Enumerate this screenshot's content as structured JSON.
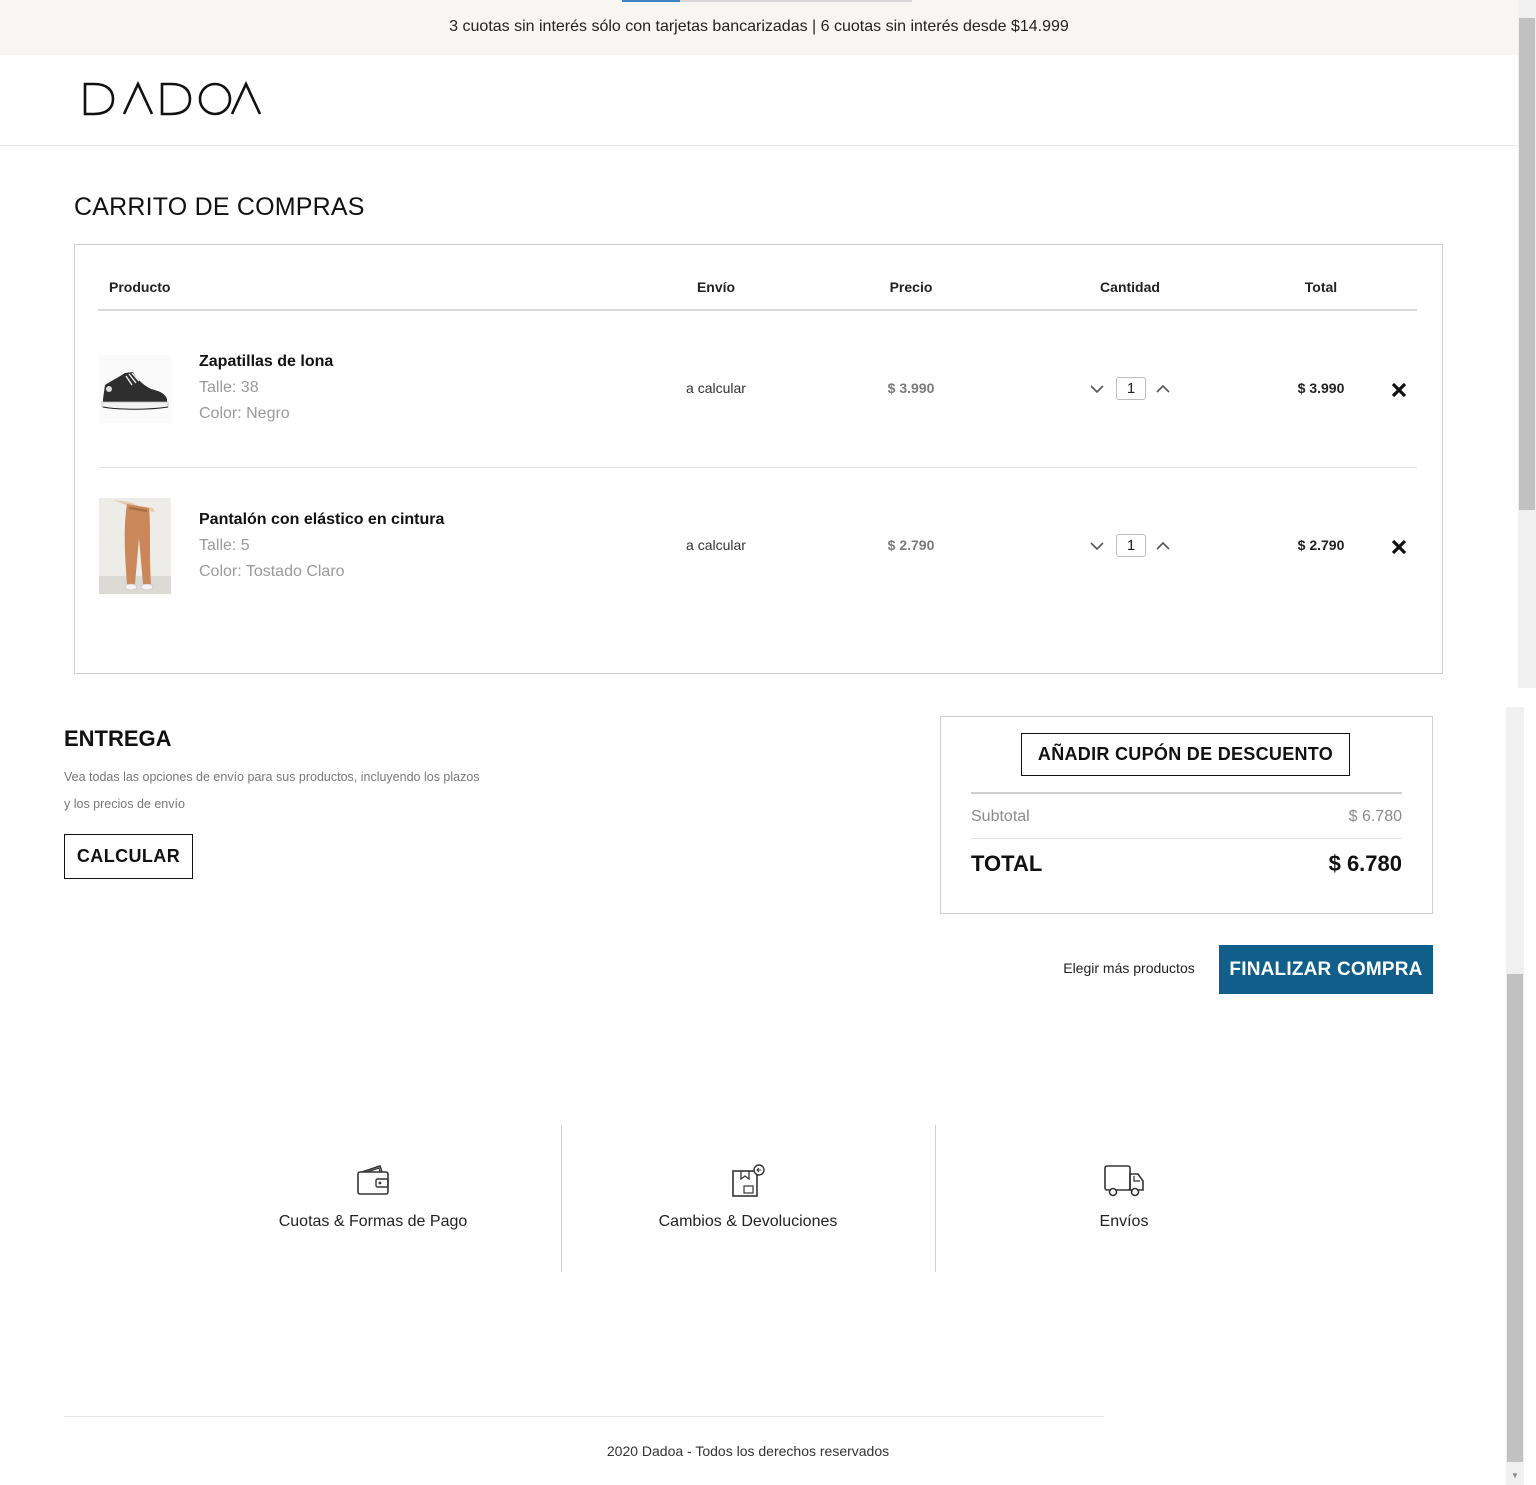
{
  "promo": {
    "text": "3 cuotas sin interés sólo con tarjetas bancarizadas | 6 cuotas sin interés desde $14.999"
  },
  "brand": {
    "name": "DADOA"
  },
  "cart": {
    "title": "CARRITO DE COMPRAS",
    "columns": {
      "product": "Producto",
      "shipping": "Envío",
      "price": "Precio",
      "quantity": "Cantidad",
      "total": "Total"
    },
    "items": [
      {
        "name": "Zapatillas de lona",
        "size": "Talle: 38",
        "color": "Color: Negro",
        "shipping": "a calcular",
        "price": "$ 3.990",
        "quantity": "1",
        "total": "$ 3.990",
        "image_icon": "sneaker-image"
      },
      {
        "name": "Pantalón con elástico en cintura",
        "size": "Talle: 5",
        "color": "Color: Tostado Claro",
        "shipping": "a calcular",
        "price": "$ 2.790",
        "quantity": "1",
        "total": "$ 2.790",
        "image_icon": "pants-image"
      }
    ]
  },
  "delivery": {
    "title": "ENTREGA",
    "description": "Vea todas las opciones de envío para sus productos, incluyendo los plazos y los precios de envío",
    "button": "CALCULAR"
  },
  "summary": {
    "coupon_button": "AÑADIR CUPÓN DE DESCUENTO",
    "subtotal_label": "Subtotal",
    "subtotal_value": "$ 6.780",
    "total_label": "TOTAL",
    "total_value": "$ 6.780"
  },
  "actions": {
    "more_products": "Elegir más productos",
    "checkout": "FINALIZAR COMPRA"
  },
  "info": [
    {
      "label": "Cuotas & Formas de Pago",
      "icon": "wallet-icon"
    },
    {
      "label": "Cambios & Devoluciones",
      "icon": "return-box-icon"
    },
    {
      "label": "Envíos",
      "icon": "truck-icon"
    }
  ],
  "footer": {
    "text": "2020 Dadoa - Todos los derechos reservados"
  },
  "colors": {
    "accent": "#0f5f8a",
    "promo_bg": "#f7f6f3",
    "muted_text": "#9a9a9a"
  }
}
